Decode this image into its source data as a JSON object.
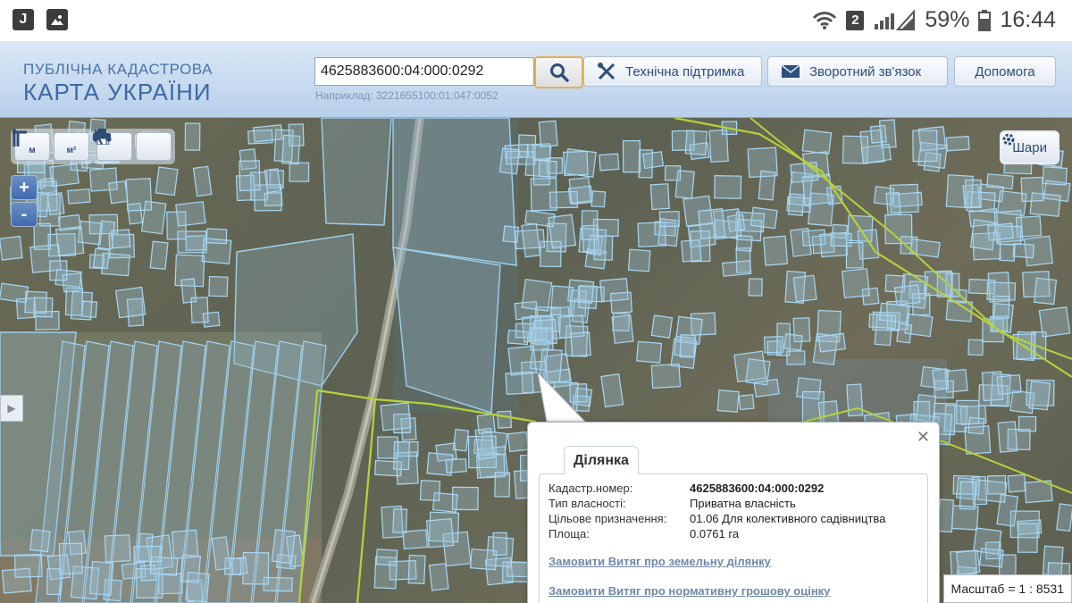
{
  "status_bar": {
    "battery": "59%",
    "time": "16:44",
    "sim": "2"
  },
  "header": {
    "logo_line1": "ПУБЛІЧНА КАДАСТРОВА",
    "logo_line2": "КАРТА УКРАЇНИ",
    "search_value": "4625883600:04:000:0292",
    "example": "Наприклад: 3221655100:01:047:0052",
    "buttons": [
      "Технічна підтримка",
      "Зворотний зв'язок",
      "Допомога"
    ]
  },
  "map": {
    "tools": {
      "m": "м",
      "mp": "м²",
      "zoom_in": "+",
      "zoom_out": "-"
    },
    "layers_label": "Шари",
    "scale": "Масштаб = 1 : 8531"
  },
  "popup": {
    "tab": "Ділянка",
    "rows": [
      {
        "k": "Кадастр.номер:",
        "v": "4625883600:04:000:0292"
      },
      {
        "k": "Тип власності:",
        "v": "Приватна власність"
      },
      {
        "k": "Цільове призначення:",
        "v": "01.06 Для колективного садівництва"
      },
      {
        "k": "Площа:",
        "v": "0.0761 га"
      }
    ],
    "links": [
      "Замовити Витяг про земельну ділянку",
      "Замовити Витяг про нормативну грошову оцінку"
    ]
  }
}
